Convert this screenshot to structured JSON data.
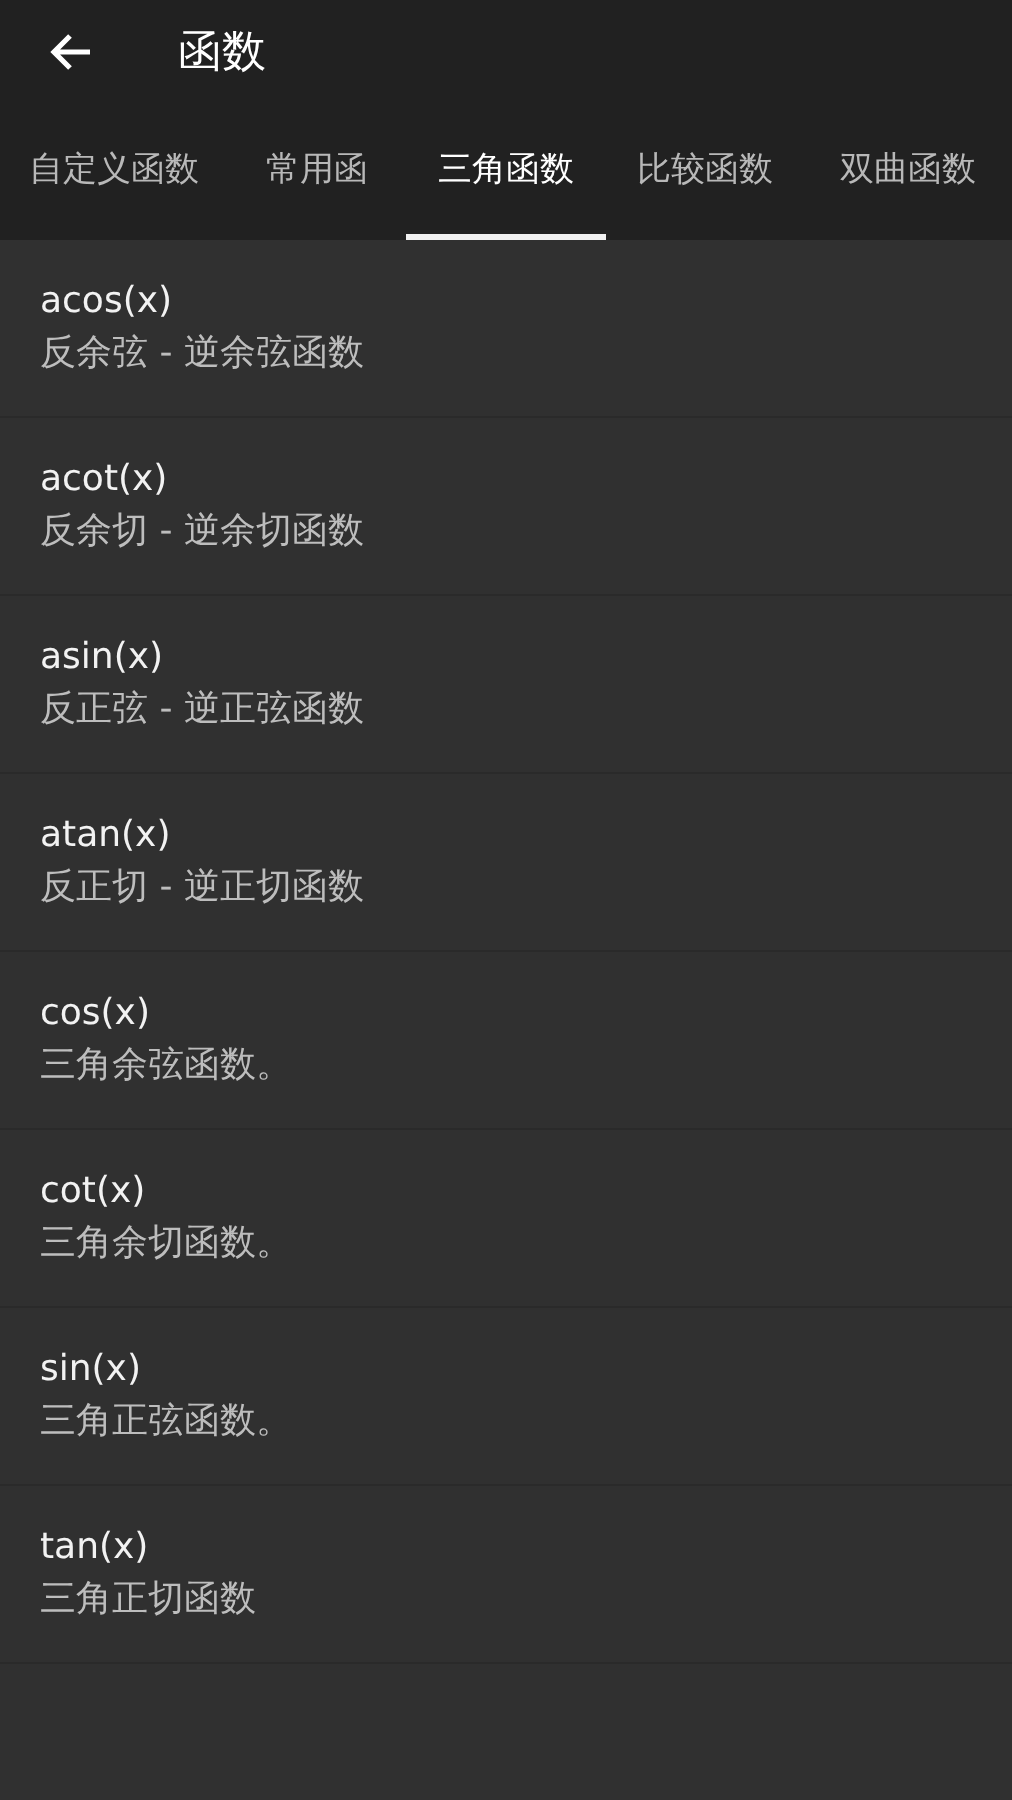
{
  "app_bar": {
    "title": "函数"
  },
  "tabs": [
    {
      "label": "自定义函数",
      "selected": false
    },
    {
      "label": "常用函",
      "selected": false
    },
    {
      "label": "三角函数",
      "selected": true
    },
    {
      "label": "比较函数",
      "selected": false
    },
    {
      "label": "双曲函数",
      "selected": false
    }
  ],
  "functions": [
    {
      "name": "acos(x)",
      "description": "反余弦 - 逆余弦函数"
    },
    {
      "name": "acot(x)",
      "description": "反余切 - 逆余切函数"
    },
    {
      "name": "asin(x)",
      "description": "反正弦 - 逆正弦函数"
    },
    {
      "name": "atan(x)",
      "description": "反正切 - 逆正切函数"
    },
    {
      "name": "cos(x)",
      "description": "三角余弦函数。"
    },
    {
      "name": "cot(x)",
      "description": "三角余切函数。"
    },
    {
      "name": "sin(x)",
      "description": "三角正弦函数。"
    },
    {
      "name": "tan(x)",
      "description": "三角正切函数"
    }
  ]
}
